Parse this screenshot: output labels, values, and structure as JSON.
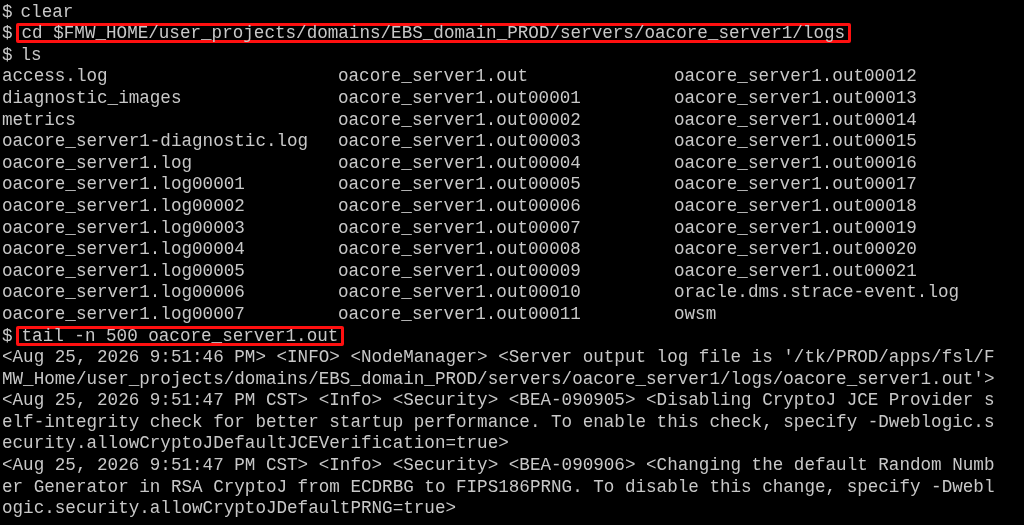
{
  "terminal": {
    "lines": [
      {
        "kind": "prompt",
        "prompt": "$",
        "command": "clear",
        "highlighted": false
      },
      {
        "kind": "prompt",
        "prompt": "$",
        "command": "cd $FMW_HOME/user_projects/domains/EBS_domain_PROD/servers/oacore_server1/logs",
        "highlighted": true
      },
      {
        "kind": "prompt",
        "prompt": "$",
        "command": "ls",
        "highlighted": false
      },
      {
        "kind": "listing",
        "entries": [
          "access.log",
          "oacore_server1.out",
          "oacore_server1.out00012"
        ]
      },
      {
        "kind": "listing",
        "entries": [
          "diagnostic_images",
          "oacore_server1.out00001",
          "oacore_server1.out00013"
        ]
      },
      {
        "kind": "listing",
        "entries": [
          "metrics",
          "oacore_server1.out00002",
          "oacore_server1.out00014"
        ]
      },
      {
        "kind": "listing",
        "entries": [
          "oacore_server1-diagnostic.log",
          "oacore_server1.out00003",
          "oacore_server1.out00015"
        ]
      },
      {
        "kind": "listing",
        "entries": [
          "oacore_server1.log",
          "oacore_server1.out00004",
          "oacore_server1.out00016"
        ]
      },
      {
        "kind": "listing",
        "entries": [
          "oacore_server1.log00001",
          "oacore_server1.out00005",
          "oacore_server1.out00017"
        ]
      },
      {
        "kind": "listing",
        "entries": [
          "oacore_server1.log00002",
          "oacore_server1.out00006",
          "oacore_server1.out00018"
        ]
      },
      {
        "kind": "listing",
        "entries": [
          "oacore_server1.log00003",
          "oacore_server1.out00007",
          "oacore_server1.out00019"
        ]
      },
      {
        "kind": "listing",
        "entries": [
          "oacore_server1.log00004",
          "oacore_server1.out00008",
          "oacore_server1.out00020"
        ]
      },
      {
        "kind": "listing",
        "entries": [
          "oacore_server1.log00005",
          "oacore_server1.out00009",
          "oacore_server1.out00021"
        ]
      },
      {
        "kind": "listing",
        "entries": [
          "oacore_server1.log00006",
          "oacore_server1.out00010",
          "oracle.dms.strace-event.log"
        ]
      },
      {
        "kind": "listing",
        "entries": [
          "oacore_server1.log00007",
          "oacore_server1.out00011",
          "owsm"
        ]
      },
      {
        "kind": "prompt",
        "prompt": "$",
        "command": "tail -n 500 oacore_server1.out",
        "highlighted": true
      },
      {
        "kind": "output",
        "text": "<Aug 25, 2026 9:51:46 PM> <INFO> <NodeManager> <Server output log file is '/tk/PROD/apps/fsl/F"
      },
      {
        "kind": "output",
        "text": "MW_Home/user_projects/domains/EBS_domain_PROD/servers/oacore_server1/logs/oacore_server1.out'>"
      },
      {
        "kind": "output",
        "text": "<Aug 25, 2026 9:51:47 PM CST> <Info> <Security> <BEA-090905> <Disabling CryptoJ JCE Provider s"
      },
      {
        "kind": "output",
        "text": "elf-integrity check for better startup performance. To enable this check, specify -Dweblogic.s"
      },
      {
        "kind": "output",
        "text": "ecurity.allowCryptoJDefaultJCEVerification=true>"
      },
      {
        "kind": "output",
        "text": "<Aug 25, 2026 9:51:47 PM CST> <Info> <Security> <BEA-090906> <Changing the default Random Numb"
      },
      {
        "kind": "output",
        "text": "er Generator in RSA CryptoJ from ECDRBG to FIPS186PRNG. To disable this change, specify -Dwebl"
      },
      {
        "kind": "output",
        "text": "ogic.security.allowCryptoJDefaultPRNG=true>"
      }
    ]
  }
}
